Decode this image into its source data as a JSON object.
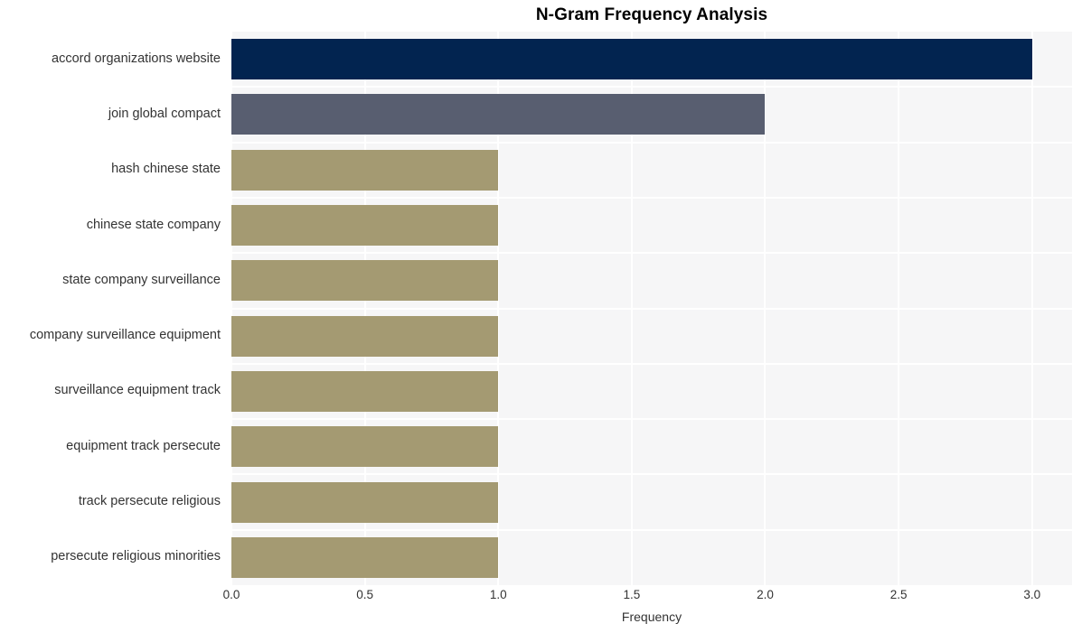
{
  "chart_data": {
    "type": "bar",
    "orientation": "horizontal",
    "title": "N-Gram Frequency Analysis",
    "xlabel": "Frequency",
    "ylabel": "",
    "xlim": [
      0.0,
      3.15
    ],
    "xticks": [
      "0.0",
      "0.5",
      "1.0",
      "1.5",
      "2.0",
      "2.5",
      "3.0"
    ],
    "xtick_values": [
      0.0,
      0.5,
      1.0,
      1.5,
      2.0,
      2.5,
      3.0
    ],
    "grid": true,
    "legend": "none",
    "categories": [
      "accord organizations website",
      "join global compact",
      "hash chinese state",
      "chinese state company",
      "state company surveillance",
      "company surveillance equipment",
      "surveillance equipment track",
      "equipment track persecute",
      "track persecute religious",
      "persecute religious minorities"
    ],
    "values": [
      3,
      2,
      1,
      1,
      1,
      1,
      1,
      1,
      1,
      1
    ],
    "bar_colors": [
      "#022450",
      "#585e70",
      "#a49a72",
      "#a49a72",
      "#a49a72",
      "#a49a72",
      "#a49a72",
      "#a49a72",
      "#a49a72",
      "#a49a72"
    ],
    "plot_background": "#f6f6f7",
    "grid_color": "#ffffff",
    "figure_background": "#ffffff",
    "title_color": "#000000",
    "tick_color": "#333333"
  }
}
